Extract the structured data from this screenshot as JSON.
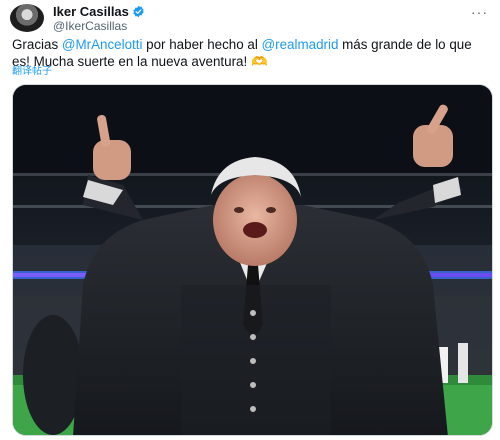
{
  "tweet": {
    "author_name": "Iker Casillas",
    "author_handle": "@IkerCasillas",
    "text_parts": {
      "p1": "Gracias ",
      "mention1": "@MrAncelotti",
      "p2": " por haber hecho al ",
      "mention2": "@realmadrid",
      "p3": " más grande de lo que es! Mucha suerte en la nueva aventura! ",
      "emoji": "🫶"
    },
    "translate_label": "翻译帖子",
    "more_label": "···"
  },
  "icons": {
    "verified": "verified-badge-icon",
    "more": "more-options-icon"
  },
  "colors": {
    "accent": "#1d9bf0",
    "text": "#0f1419",
    "muted": "#536471"
  }
}
